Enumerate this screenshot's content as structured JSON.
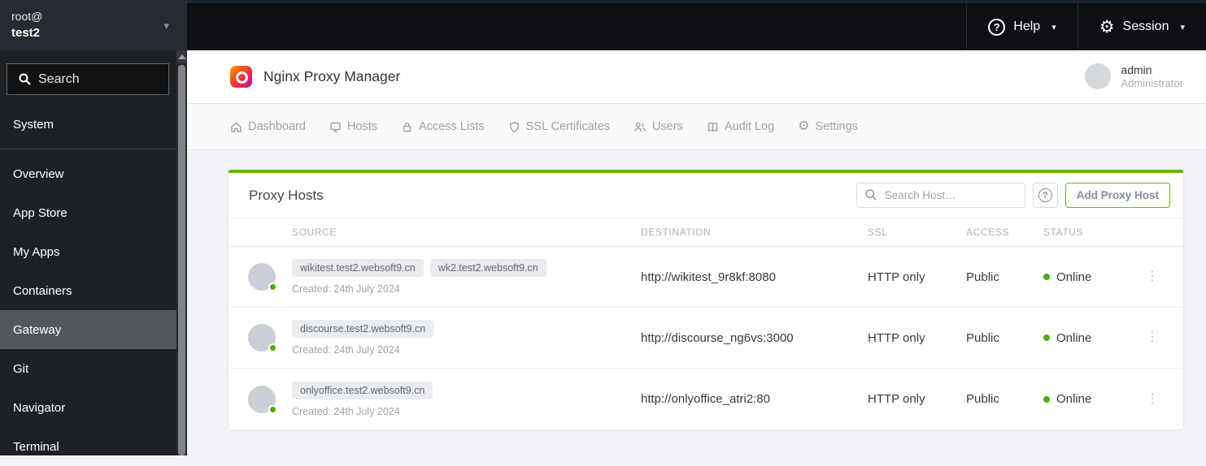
{
  "shell": {
    "host_menu": {
      "user": "root@",
      "host": "test2"
    },
    "search_placeholder": "Search",
    "nav": {
      "system_label": "System",
      "items": [
        "Overview",
        "App Store",
        "My Apps",
        "Containers",
        "Gateway",
        "Git",
        "Navigator",
        "Terminal"
      ],
      "active_item": "Gateway"
    },
    "topbar": {
      "help_label": "Help",
      "session_label": "Session",
      "help_glyph": "?",
      "gear_glyph": "⚙",
      "caret_glyph": "▾"
    }
  },
  "app": {
    "title": "Nginx Proxy Manager",
    "user": {
      "name": "admin",
      "role": "Administrator"
    },
    "tabs": [
      "Dashboard",
      "Hosts",
      "Access Lists",
      "SSL Certificates",
      "Users",
      "Audit Log",
      "Settings"
    ],
    "settings_tab_gear_glyph": "⚙"
  },
  "panel": {
    "title": "Proxy Hosts",
    "search_placeholder": "Search Host…",
    "help_button_glyph": "?",
    "add_button_label": "Add Proxy Host",
    "kebab_glyph": "⋮",
    "table": {
      "columns": {
        "source": "SOURCE",
        "destination": "DESTINATION",
        "ssl": "SSL",
        "access": "ACCESS",
        "status": "STATUS"
      },
      "rows": [
        {
          "sources": [
            "wikitest.test2.websoft9.cn",
            "wk2.test2.websoft9.cn"
          ],
          "created": "Created: 24th July 2024",
          "destination": "http://wikitest_9r8kf:8080",
          "ssl": "HTTP only",
          "access": "Public",
          "status": "Online"
        },
        {
          "sources": [
            "discourse.test2.websoft9.cn"
          ],
          "created": "Created: 24th July 2024",
          "destination": "http://discourse_ng6vs:3000",
          "ssl": "HTTP only",
          "access": "Public",
          "status": "Online"
        },
        {
          "sources": [
            "onlyoffice.test2.websoft9.cn"
          ],
          "created": "Created: 24th July 2024",
          "destination": "http://onlyoffice_atri2:80",
          "ssl": "HTTP only",
          "access": "Public",
          "status": "Online"
        }
      ]
    }
  },
  "colors": {
    "accent_green": "#5eba00",
    "status_online": "#4cae00",
    "sidebar_bg": "#1d2025",
    "topbar_bg": "#0e1013"
  }
}
